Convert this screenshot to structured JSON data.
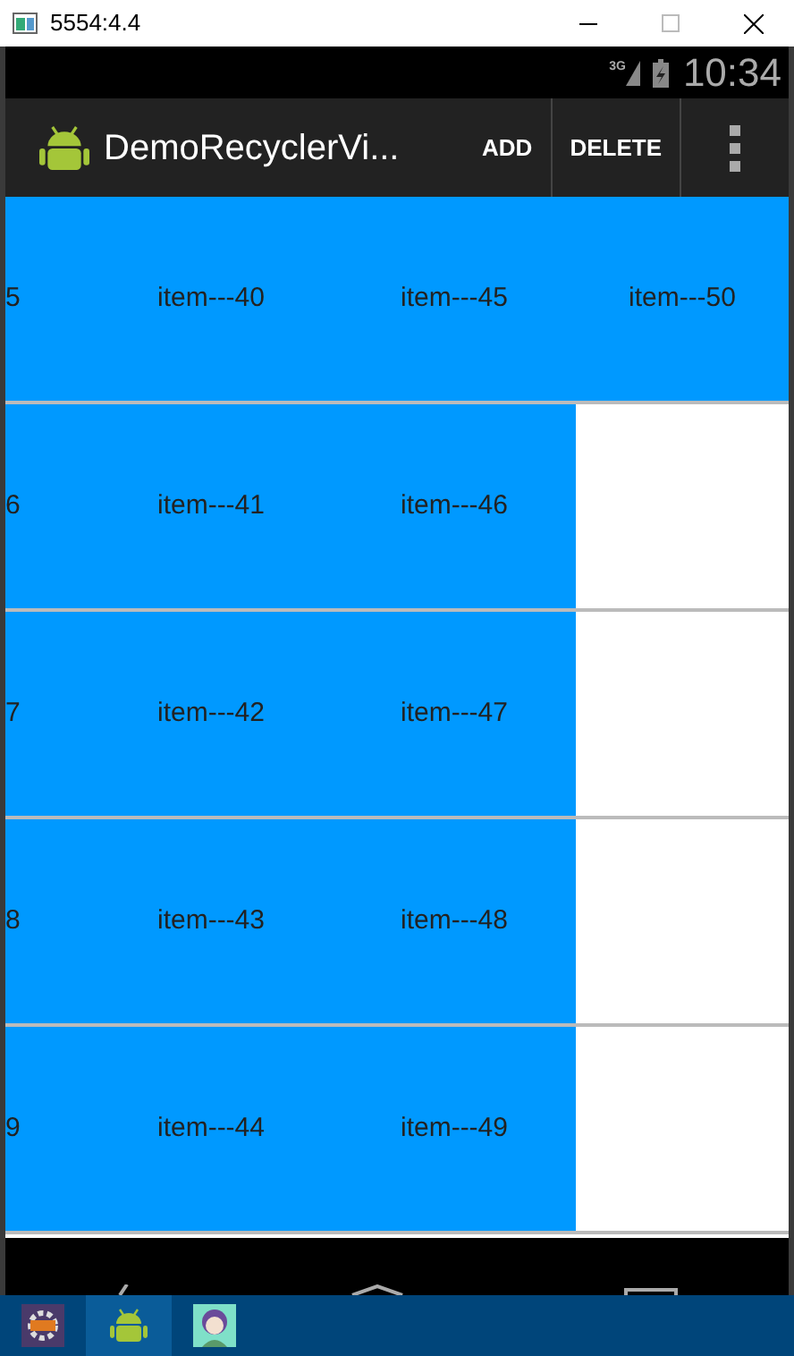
{
  "window": {
    "title": "5554:4.4"
  },
  "status_bar": {
    "network": "3G",
    "time": "10:34"
  },
  "action_bar": {
    "title": "DemoRecyclerVi...",
    "actions": [
      "ADD",
      "DELETE"
    ]
  },
  "grid": {
    "rows": [
      {
        "cells": [
          "5",
          "item---40",
          "item---45",
          "item---50"
        ]
      },
      {
        "cells": [
          "6",
          "item---41",
          "item---46"
        ]
      },
      {
        "cells": [
          "7",
          "item---42",
          "item---47"
        ]
      },
      {
        "cells": [
          "8",
          "item---43",
          "item---48"
        ]
      },
      {
        "cells": [
          "9",
          "item---44",
          "item---49"
        ]
      }
    ]
  },
  "taskbar": {
    "apps": [
      {
        "selected": false
      },
      {
        "selected": true
      },
      {
        "selected": false
      }
    ]
  }
}
